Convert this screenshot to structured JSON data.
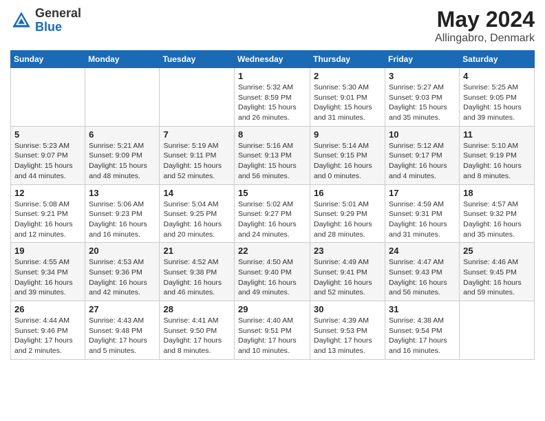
{
  "header": {
    "logo_general": "General",
    "logo_blue": "Blue",
    "title": "May 2024",
    "location": "Allingabro, Denmark"
  },
  "calendar": {
    "days_of_week": [
      "Sunday",
      "Monday",
      "Tuesday",
      "Wednesday",
      "Thursday",
      "Friday",
      "Saturday"
    ],
    "weeks": [
      [
        {
          "day": "",
          "info": ""
        },
        {
          "day": "",
          "info": ""
        },
        {
          "day": "",
          "info": ""
        },
        {
          "day": "1",
          "info": "Sunrise: 5:32 AM\nSunset: 8:59 PM\nDaylight: 15 hours and 26 minutes."
        },
        {
          "day": "2",
          "info": "Sunrise: 5:30 AM\nSunset: 9:01 PM\nDaylight: 15 hours and 31 minutes."
        },
        {
          "day": "3",
          "info": "Sunrise: 5:27 AM\nSunset: 9:03 PM\nDaylight: 15 hours and 35 minutes."
        },
        {
          "day": "4",
          "info": "Sunrise: 5:25 AM\nSunset: 9:05 PM\nDaylight: 15 hours and 39 minutes."
        }
      ],
      [
        {
          "day": "5",
          "info": "Sunrise: 5:23 AM\nSunset: 9:07 PM\nDaylight: 15 hours and 44 minutes."
        },
        {
          "day": "6",
          "info": "Sunrise: 5:21 AM\nSunset: 9:09 PM\nDaylight: 15 hours and 48 minutes."
        },
        {
          "day": "7",
          "info": "Sunrise: 5:19 AM\nSunset: 9:11 PM\nDaylight: 15 hours and 52 minutes."
        },
        {
          "day": "8",
          "info": "Sunrise: 5:16 AM\nSunset: 9:13 PM\nDaylight: 15 hours and 56 minutes."
        },
        {
          "day": "9",
          "info": "Sunrise: 5:14 AM\nSunset: 9:15 PM\nDaylight: 16 hours and 0 minutes."
        },
        {
          "day": "10",
          "info": "Sunrise: 5:12 AM\nSunset: 9:17 PM\nDaylight: 16 hours and 4 minutes."
        },
        {
          "day": "11",
          "info": "Sunrise: 5:10 AM\nSunset: 9:19 PM\nDaylight: 16 hours and 8 minutes."
        }
      ],
      [
        {
          "day": "12",
          "info": "Sunrise: 5:08 AM\nSunset: 9:21 PM\nDaylight: 16 hours and 12 minutes."
        },
        {
          "day": "13",
          "info": "Sunrise: 5:06 AM\nSunset: 9:23 PM\nDaylight: 16 hours and 16 minutes."
        },
        {
          "day": "14",
          "info": "Sunrise: 5:04 AM\nSunset: 9:25 PM\nDaylight: 16 hours and 20 minutes."
        },
        {
          "day": "15",
          "info": "Sunrise: 5:02 AM\nSunset: 9:27 PM\nDaylight: 16 hours and 24 minutes."
        },
        {
          "day": "16",
          "info": "Sunrise: 5:01 AM\nSunset: 9:29 PM\nDaylight: 16 hours and 28 minutes."
        },
        {
          "day": "17",
          "info": "Sunrise: 4:59 AM\nSunset: 9:31 PM\nDaylight: 16 hours and 31 minutes."
        },
        {
          "day": "18",
          "info": "Sunrise: 4:57 AM\nSunset: 9:32 PM\nDaylight: 16 hours and 35 minutes."
        }
      ],
      [
        {
          "day": "19",
          "info": "Sunrise: 4:55 AM\nSunset: 9:34 PM\nDaylight: 16 hours and 39 minutes."
        },
        {
          "day": "20",
          "info": "Sunrise: 4:53 AM\nSunset: 9:36 PM\nDaylight: 16 hours and 42 minutes."
        },
        {
          "day": "21",
          "info": "Sunrise: 4:52 AM\nSunset: 9:38 PM\nDaylight: 16 hours and 46 minutes."
        },
        {
          "day": "22",
          "info": "Sunrise: 4:50 AM\nSunset: 9:40 PM\nDaylight: 16 hours and 49 minutes."
        },
        {
          "day": "23",
          "info": "Sunrise: 4:49 AM\nSunset: 9:41 PM\nDaylight: 16 hours and 52 minutes."
        },
        {
          "day": "24",
          "info": "Sunrise: 4:47 AM\nSunset: 9:43 PM\nDaylight: 16 hours and 56 minutes."
        },
        {
          "day": "25",
          "info": "Sunrise: 4:46 AM\nSunset: 9:45 PM\nDaylight: 16 hours and 59 minutes."
        }
      ],
      [
        {
          "day": "26",
          "info": "Sunrise: 4:44 AM\nSunset: 9:46 PM\nDaylight: 17 hours and 2 minutes."
        },
        {
          "day": "27",
          "info": "Sunrise: 4:43 AM\nSunset: 9:48 PM\nDaylight: 17 hours and 5 minutes."
        },
        {
          "day": "28",
          "info": "Sunrise: 4:41 AM\nSunset: 9:50 PM\nDaylight: 17 hours and 8 minutes."
        },
        {
          "day": "29",
          "info": "Sunrise: 4:40 AM\nSunset: 9:51 PM\nDaylight: 17 hours and 10 minutes."
        },
        {
          "day": "30",
          "info": "Sunrise: 4:39 AM\nSunset: 9:53 PM\nDaylight: 17 hours and 13 minutes."
        },
        {
          "day": "31",
          "info": "Sunrise: 4:38 AM\nSunset: 9:54 PM\nDaylight: 17 hours and 16 minutes."
        },
        {
          "day": "",
          "info": ""
        }
      ]
    ]
  }
}
